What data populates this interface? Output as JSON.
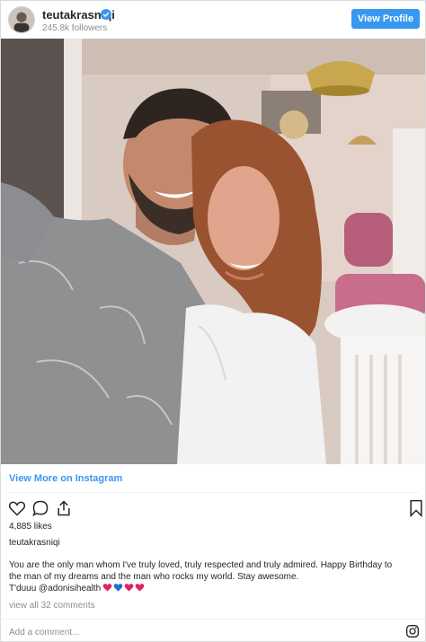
{
  "header": {
    "username": "teutakrasniqi",
    "followers": "245.8k followers",
    "view_profile_label": "View Profile"
  },
  "post": {
    "view_more_label": "View More on Instagram",
    "likes": "4,885 likes",
    "owner": "teutakrasniqi",
    "caption_lines": [
      "You are the only man whom I've truly loved, truly respected and truly admired. Happy Birthday to",
      "the man of my dreams and the man who rocks my world. Stay awesome.",
      "T'duuu @adonisihealth"
    ],
    "hearts": [
      "#e0245e",
      "#1d6fd8",
      "#e0245e",
      "#e0245e"
    ],
    "comments_link": "view all 32 comments",
    "add_comment_placeholder": "Add a comment..."
  },
  "colors": {
    "accent": "#3897f0",
    "verified": "#3897f0"
  },
  "icons": {
    "like": "heart-outline-icon",
    "comment": "comment-bubble-icon",
    "share": "share-icon",
    "save": "bookmark-icon",
    "instagram": "instagram-logo-icon"
  }
}
